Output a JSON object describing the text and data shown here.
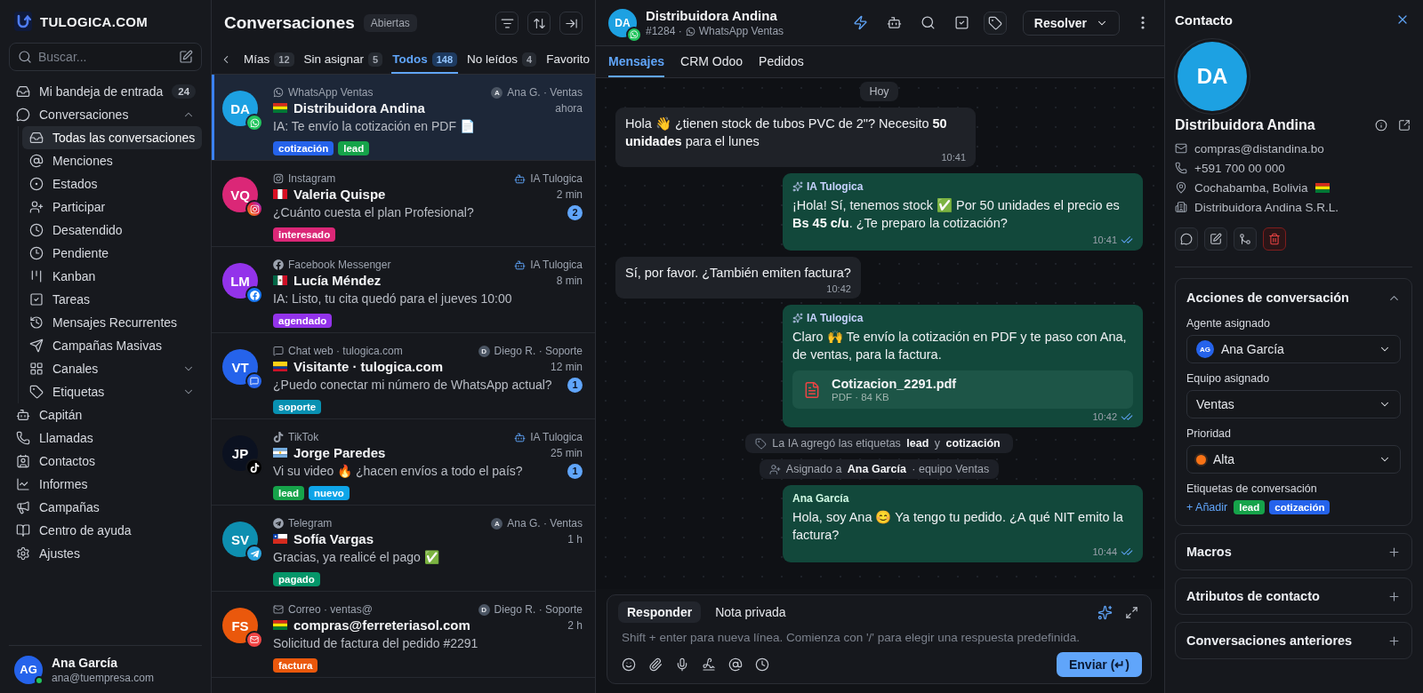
{
  "sidebar": {
    "brand": "TULOGICA.COM",
    "search": {
      "placeholder": "Buscar..."
    },
    "items": [
      {
        "label": "Mi bandeja de entrada",
        "count": "24",
        "selected": false
      },
      {
        "label": "Conversaciones",
        "selected": false,
        "expanded": true,
        "children": [
          {
            "label": "Todas las conversaciones",
            "selected": true
          },
          {
            "label": "Menciones",
            "selected": false
          },
          {
            "label": "Estados",
            "selected": false
          },
          {
            "label": "Participar",
            "selected": false
          },
          {
            "label": "Desatendido",
            "selected": false
          },
          {
            "label": "Pendiente",
            "selected": false
          },
          {
            "label": "Kanban",
            "selected": false
          },
          {
            "label": "Tareas",
            "selected": false
          },
          {
            "label": "Mensajes Recurrentes",
            "selected": false
          },
          {
            "label": "Campañas Masivas",
            "selected": false
          },
          {
            "label": "Canales",
            "selected": false,
            "expanded": false
          },
          {
            "label": "Etiquetas",
            "selected": false,
            "expanded": false
          }
        ]
      },
      {
        "label": "Capitán",
        "selected": false
      },
      {
        "label": "Llamadas",
        "selected": false
      },
      {
        "label": "Contactos",
        "selected": false
      },
      {
        "label": "Informes",
        "selected": false
      },
      {
        "label": "Campañas",
        "selected": false
      },
      {
        "label": "Centro de ayuda",
        "selected": false
      },
      {
        "label": "Ajustes",
        "selected": false
      }
    ],
    "user": {
      "initials": "AG",
      "name": "Ana García",
      "email": "ana@tuempresa.com",
      "online": true
    }
  },
  "conversation_list": {
    "title": "Conversaciones",
    "status_filter": "Abiertas",
    "tabs": [
      {
        "label": "Mías",
        "count": "12",
        "selected": false
      },
      {
        "label": "Sin asignar",
        "count": "5",
        "selected": false
      },
      {
        "label": "Todos",
        "count": "148",
        "selected": true
      },
      {
        "label": "No leídos",
        "count": "4",
        "selected": false
      },
      {
        "label": "Favorito",
        "selected": false
      }
    ],
    "items": [
      {
        "initials": "DA",
        "color": "#1da1e2",
        "kind": "whatsapp",
        "channel_label": "WhatsApp Ventas",
        "assignee": {
          "kind": "agent",
          "initial": "A",
          "label": "Ana G. · Ventas"
        },
        "name": "Distribuidora Andina",
        "time": "ahora",
        "preview": "IA: Te envío la cotización en PDF 📄",
        "tags": [
          {
            "label": "cotización",
            "color": "#2563eb"
          },
          {
            "label": "lead",
            "color": "#16a34a"
          }
        ],
        "selected": true
      },
      {
        "initials": "VQ",
        "color": "#db2777",
        "kind": "instagram",
        "channel_label": "Instagram",
        "assignee": {
          "kind": "bot",
          "label": "IA Tulogica"
        },
        "name": "Valeria Quispe",
        "time": "2 min",
        "preview": "¿Cuánto cuesta el plan Profesional?",
        "unread": "2",
        "tags": [
          {
            "label": "interesado",
            "color": "#db2777"
          }
        ],
        "selected": false
      },
      {
        "initials": "LM",
        "color": "#9333ea",
        "kind": "facebook",
        "channel_label": "Facebook Messenger",
        "assignee": {
          "kind": "bot",
          "label": "IA Tulogica"
        },
        "name": "Lucía Méndez",
        "time": "8 min",
        "preview": "IA: Listo, tu cita quedó para el jueves 10:00",
        "tags": [
          {
            "label": "agendado",
            "color": "#9333ea"
          }
        ],
        "selected": false
      },
      {
        "initials": "VT",
        "color": "#2563eb",
        "kind": "web",
        "channel_label": "Chat web · tulogica.com",
        "assignee": {
          "kind": "agent",
          "initial": "D",
          "label": "Diego R. · Soporte"
        },
        "name": "Visitante · tulogica.com",
        "time": "12 min",
        "preview": "¿Puedo conectar mi número de WhatsApp actual?",
        "unread": "1",
        "tags": [
          {
            "label": "soporte",
            "color": "#0891b2"
          }
        ],
        "selected": false
      },
      {
        "initials": "JP",
        "color": "#0b1120",
        "kind": "tiktok",
        "channel_label": "TikTok",
        "assignee": {
          "kind": "bot",
          "label": "IA Tulogica"
        },
        "name": "Jorge Paredes",
        "time": "25 min",
        "preview": "Vi su video 🔥 ¿hacen envíos a todo el país?",
        "unread": "1",
        "tags": [
          {
            "label": "lead",
            "color": "#16a34a"
          },
          {
            "label": "nuevo",
            "color": "#0ea5e9"
          }
        ],
        "selected": false
      },
      {
        "initials": "SV",
        "color": "#0e8fb0",
        "kind": "telegram",
        "channel_label": "Telegram",
        "assignee": {
          "kind": "agent",
          "initial": "A",
          "label": "Ana G. · Ventas"
        },
        "name": "Sofía Vargas",
        "time": "1 h",
        "preview": "Gracias, ya realicé el pago ✅",
        "tags": [
          {
            "label": "pagado",
            "color": "#059669"
          }
        ],
        "selected": false
      },
      {
        "initials": "FS",
        "color": "#ea580c",
        "kind": "email",
        "channel_label": "Correo · ventas@",
        "assignee": {
          "kind": "agent",
          "initial": "D",
          "label": "Diego R. · Soporte"
        },
        "name": "compras@ferreteriasol.com",
        "time": "2 h",
        "preview": "Solicitud de factura del pedido #2291",
        "tags": [
          {
            "label": "factura",
            "color": "#ea580c"
          }
        ],
        "selected": false
      }
    ]
  },
  "chat": {
    "initials": "DA",
    "color": "#1da1e2",
    "kind": "whatsapp",
    "name": "Distribuidora Andina",
    "number": "#1284 ·",
    "inbox": "WhatsApp Ventas",
    "resolve_label": "Resolver",
    "tabs": [
      {
        "label": "Mensajes",
        "selected": true
      },
      {
        "label": "CRM Odoo",
        "selected": false
      },
      {
        "label": "Pedidos",
        "selected": false
      }
    ],
    "date": "Hoy",
    "messages": [
      {
        "kind": "incoming",
        "text": "Hola 👋 ¿tienen stock de tubos PVC de 2\"? Necesito **50 unidades** para el lunes",
        "time": "10:41"
      },
      {
        "kind": "outgoing",
        "sender": {
          "kind": "ai",
          "name": "IA Tulogica"
        },
        "text": "¡Hola! Sí, tenemos stock ✅ Por 50 unidades el precio es **Bs 45 c/u**. ¿Te preparo la cotización?",
        "time": "10:41",
        "read": true
      },
      {
        "kind": "incoming",
        "text": "Sí, por favor. ¿También emiten factura?",
        "time": "10:42"
      },
      {
        "kind": "outgoing",
        "sender": {
          "kind": "ai",
          "name": "IA Tulogica"
        },
        "text": "Claro 🙌 Te envío la cotización en PDF y te paso con Ana, de ventas, para la factura.",
        "attachment": {
          "name": "Cotizacion_2291.pdf",
          "meta": "PDF · 84 KB"
        },
        "time": "10:42",
        "read": true
      },
      {
        "kind": "tag_activity",
        "text": "La IA agregó las etiquetas **lead** y **cotización**"
      },
      {
        "kind": "assign_activity",
        "text": "Asignado a **Ana García** · equipo Ventas"
      },
      {
        "kind": "outgoing",
        "sender": {
          "kind": "agent",
          "name": "Ana García"
        },
        "text": "Hola, soy Ana 😊 Ya tengo tu pedido. ¿A qué NIT emito la factura?",
        "time": "10:44",
        "read": true
      }
    ],
    "composer": {
      "tabs": [
        {
          "label": "Responder",
          "selected": true
        },
        {
          "label": "Nota privada",
          "selected": false
        }
      ],
      "placeholder": "Shift + enter para nueva línea. Comienza con '/' para elegir una respuesta predefinida.",
      "send_label": "Enviar (↵)"
    }
  },
  "contact": {
    "title": "Contacto",
    "initials": "DA",
    "color": "#1da1e2",
    "name": "Distribuidora Andina",
    "details": [
      {
        "kind": "email",
        "text": "compras@distandina.bo"
      },
      {
        "kind": "phone",
        "text": "+591 700 00 000"
      },
      {
        "kind": "location",
        "text": "Cochabamba, Bolivia"
      },
      {
        "kind": "company",
        "text": "Distribuidora Andina S.R.L."
      }
    ],
    "sections": [
      {
        "title": "Acciones de conversación",
        "expanded": true,
        "fields": [
          {
            "kind": "agent",
            "label": "Agente asignado",
            "initials": "AG",
            "value": "Ana García"
          },
          {
            "kind": "select",
            "label": "Equipo asignado",
            "value": "Ventas"
          },
          {
            "kind": "priority",
            "label": "Prioridad",
            "value": "Alta",
            "color": "#f97316"
          },
          {
            "kind": "tags",
            "label": "Etiquetas de conversación",
            "add_label": "+ Añadir",
            "tags": [
              {
                "label": "lead",
                "color": "#16a34a"
              },
              {
                "label": "cotización",
                "color": "#2563eb"
              }
            ]
          }
        ]
      },
      {
        "title": "Macros",
        "expanded": false
      },
      {
        "title": "Atributos de contacto",
        "expanded": false
      },
      {
        "title": "Conversaciones anteriores",
        "expanded": false
      }
    ]
  }
}
